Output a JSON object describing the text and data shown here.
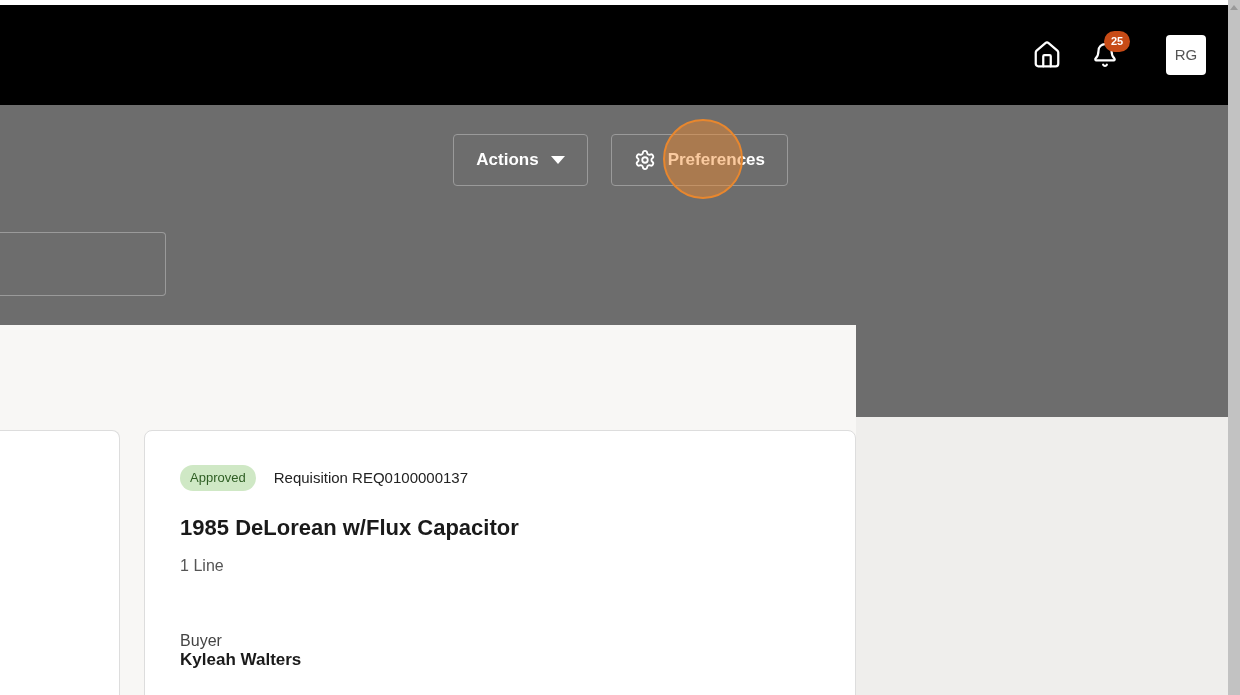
{
  "header": {
    "notifications": {
      "count": "25"
    },
    "avatar": "RG"
  },
  "toolbar": {
    "buttons": [
      {
        "label": "Actions",
        "kind": "dropdown"
      },
      {
        "label": "Preferences",
        "kind": "settings",
        "highlighted": true
      }
    ]
  },
  "card": {
    "status": "Approved",
    "reference": "Requisition REQ0100000137",
    "title": "1985 DeLorean w/Flux Capacitor",
    "lines": "1 Line",
    "buyer_label": "Buyer",
    "buyer": "Kyleah Walters"
  }
}
